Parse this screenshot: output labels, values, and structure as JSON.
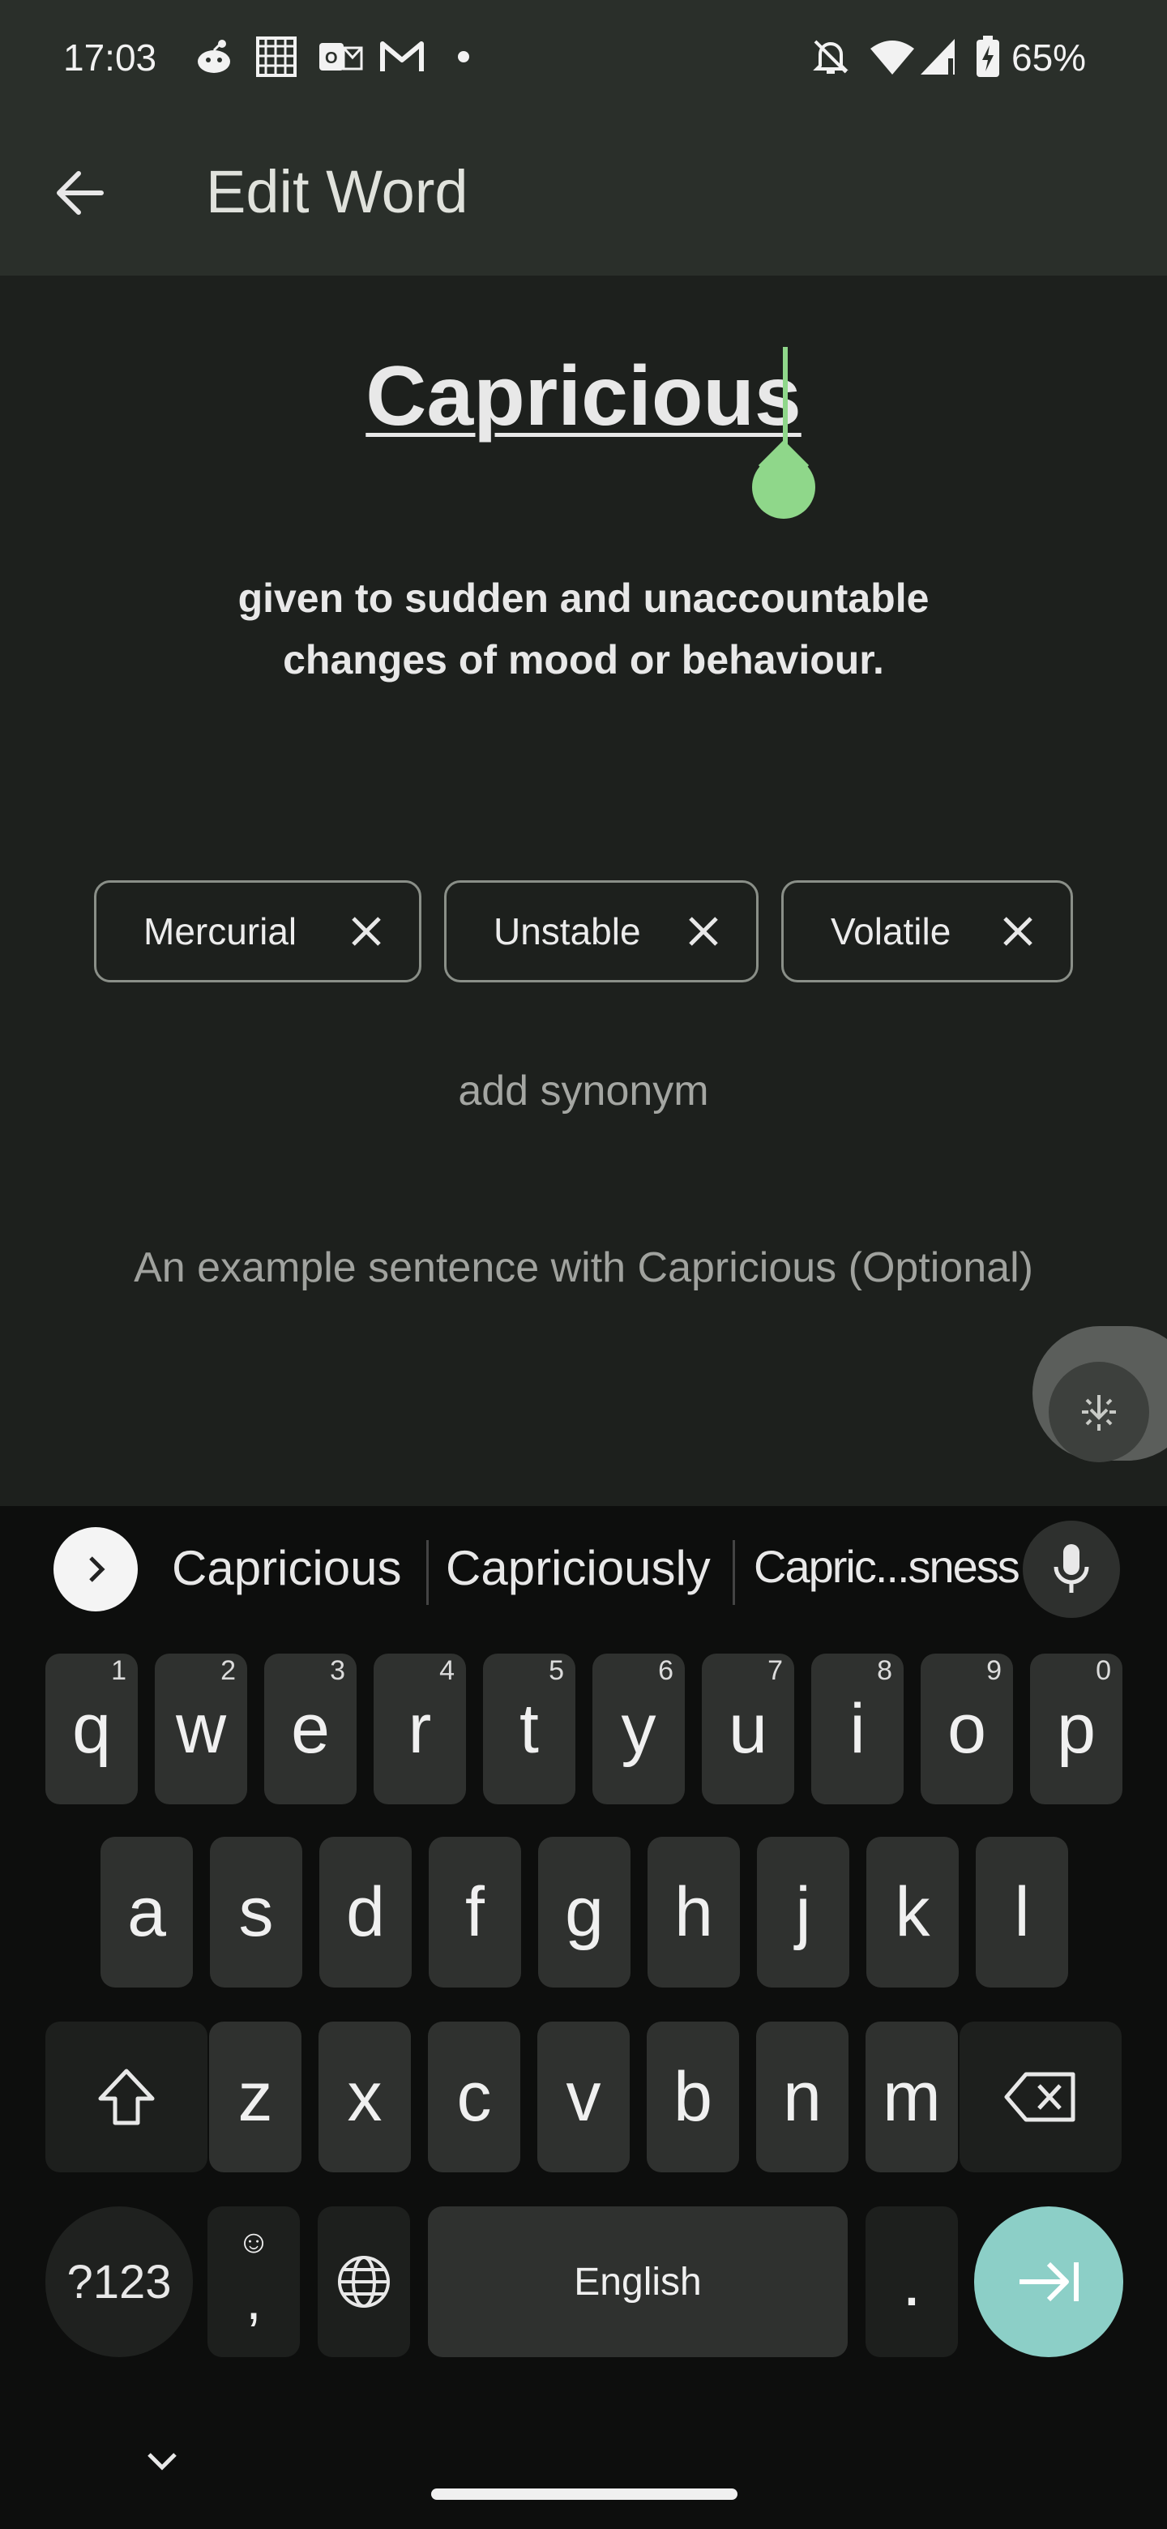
{
  "status_bar": {
    "time": "17:03",
    "battery": "65%",
    "icons": [
      "reddit-icon",
      "grid-icon",
      "outlook-icon",
      "gmail-icon",
      "dot-icon",
      "bell-off-icon",
      "wifi-icon",
      "signal-icon",
      "battery-charging-icon"
    ]
  },
  "app_bar": {
    "title": "Edit Word",
    "back_icon": "arrow-left-icon"
  },
  "word": "Capricious",
  "definition_line1": "given to sudden and unaccountable",
  "definition_line2": "changes of mood or behaviour.",
  "synonyms": [
    {
      "label": "Mercurial"
    },
    {
      "label": "Unstable"
    },
    {
      "label": "Volatile"
    }
  ],
  "add_synonym": "add synonym",
  "example_placeholder": "An example sentence with Capricious (Optional)",
  "keyboard": {
    "suggestions": [
      "Capricious",
      "Capriciously",
      "Capric...sness"
    ],
    "row1": [
      {
        "k": "q",
        "h": "1"
      },
      {
        "k": "w",
        "h": "2"
      },
      {
        "k": "e",
        "h": "3"
      },
      {
        "k": "r",
        "h": "4"
      },
      {
        "k": "t",
        "h": "5"
      },
      {
        "k": "y",
        "h": "6"
      },
      {
        "k": "u",
        "h": "7"
      },
      {
        "k": "i",
        "h": "8"
      },
      {
        "k": "o",
        "h": "9"
      },
      {
        "k": "p",
        "h": "0"
      }
    ],
    "row2": [
      "a",
      "s",
      "d",
      "f",
      "g",
      "h",
      "j",
      "k",
      "l"
    ],
    "row3": [
      "z",
      "x",
      "c",
      "v",
      "b",
      "n",
      "m"
    ],
    "symbols_label": "?123",
    "comma_label": ",",
    "space_label": "English",
    "period_label": ".",
    "accent_color": "#8ccfc7"
  }
}
